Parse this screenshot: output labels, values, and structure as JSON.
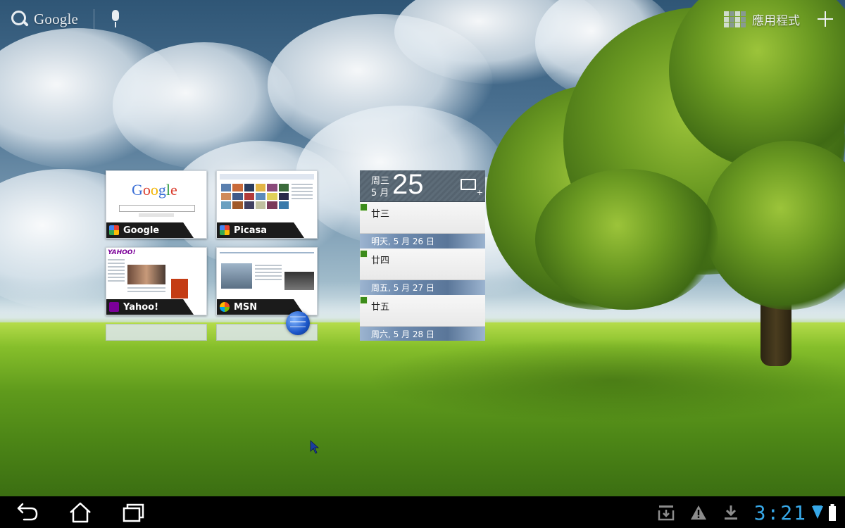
{
  "top_bar": {
    "search_label": "Google",
    "apps_label": "應用程式"
  },
  "bookmarks": [
    {
      "label": "Google",
      "favicon_color": "#ea4335"
    },
    {
      "label": "Picasa",
      "favicon_color": "#4285f4"
    },
    {
      "label": "Yahoo!",
      "favicon_color": "#7b0099"
    },
    {
      "label": "MSN",
      "favicon_color": "#00a4ef"
    }
  ],
  "calendar": {
    "weekday": "周三",
    "month": "5 月",
    "day": "25",
    "events": [
      "廿三",
      "廿四",
      "廿五"
    ],
    "dates": [
      "明天, 5 月 26 日",
      "周五, 5 月 27 日",
      "周六, 5 月 28 日"
    ]
  },
  "status_bar": {
    "time": "3:21"
  },
  "colors": {
    "clock": "#37a8e8",
    "calendar_dot": "#3c8c1a"
  }
}
